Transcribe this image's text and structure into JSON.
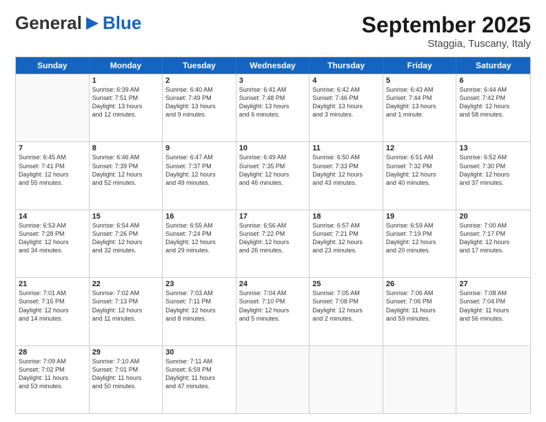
{
  "header": {
    "logo_general": "General",
    "logo_blue": "Blue",
    "month": "September 2025",
    "location": "Staggia, Tuscany, Italy"
  },
  "weekdays": [
    "Sunday",
    "Monday",
    "Tuesday",
    "Wednesday",
    "Thursday",
    "Friday",
    "Saturday"
  ],
  "rows": [
    [
      {
        "day": "",
        "lines": []
      },
      {
        "day": "1",
        "lines": [
          "Sunrise: 6:39 AM",
          "Sunset: 7:51 PM",
          "Daylight: 13 hours",
          "and 12 minutes."
        ]
      },
      {
        "day": "2",
        "lines": [
          "Sunrise: 6:40 AM",
          "Sunset: 7:49 PM",
          "Daylight: 13 hours",
          "and 9 minutes."
        ]
      },
      {
        "day": "3",
        "lines": [
          "Sunrise: 6:41 AM",
          "Sunset: 7:48 PM",
          "Daylight: 13 hours",
          "and 6 minutes."
        ]
      },
      {
        "day": "4",
        "lines": [
          "Sunrise: 6:42 AM",
          "Sunset: 7:46 PM",
          "Daylight: 13 hours",
          "and 3 minutes."
        ]
      },
      {
        "day": "5",
        "lines": [
          "Sunrise: 6:43 AM",
          "Sunset: 7:44 PM",
          "Daylight: 13 hours",
          "and 1 minute."
        ]
      },
      {
        "day": "6",
        "lines": [
          "Sunrise: 6:44 AM",
          "Sunset: 7:42 PM",
          "Daylight: 12 hours",
          "and 58 minutes."
        ]
      }
    ],
    [
      {
        "day": "7",
        "lines": [
          "Sunrise: 6:45 AM",
          "Sunset: 7:41 PM",
          "Daylight: 12 hours",
          "and 55 minutes."
        ]
      },
      {
        "day": "8",
        "lines": [
          "Sunrise: 6:46 AM",
          "Sunset: 7:39 PM",
          "Daylight: 12 hours",
          "and 52 minutes."
        ]
      },
      {
        "day": "9",
        "lines": [
          "Sunrise: 6:47 AM",
          "Sunset: 7:37 PM",
          "Daylight: 12 hours",
          "and 49 minutes."
        ]
      },
      {
        "day": "10",
        "lines": [
          "Sunrise: 6:49 AM",
          "Sunset: 7:35 PM",
          "Daylight: 12 hours",
          "and 46 minutes."
        ]
      },
      {
        "day": "11",
        "lines": [
          "Sunrise: 6:50 AM",
          "Sunset: 7:33 PM",
          "Daylight: 12 hours",
          "and 43 minutes."
        ]
      },
      {
        "day": "12",
        "lines": [
          "Sunrise: 6:51 AM",
          "Sunset: 7:32 PM",
          "Daylight: 12 hours",
          "and 40 minutes."
        ]
      },
      {
        "day": "13",
        "lines": [
          "Sunrise: 6:52 AM",
          "Sunset: 7:30 PM",
          "Daylight: 12 hours",
          "and 37 minutes."
        ]
      }
    ],
    [
      {
        "day": "14",
        "lines": [
          "Sunrise: 6:53 AM",
          "Sunset: 7:28 PM",
          "Daylight: 12 hours",
          "and 34 minutes."
        ]
      },
      {
        "day": "15",
        "lines": [
          "Sunrise: 6:54 AM",
          "Sunset: 7:26 PM",
          "Daylight: 12 hours",
          "and 32 minutes."
        ]
      },
      {
        "day": "16",
        "lines": [
          "Sunrise: 6:55 AM",
          "Sunset: 7:24 PM",
          "Daylight: 12 hours",
          "and 29 minutes."
        ]
      },
      {
        "day": "17",
        "lines": [
          "Sunrise: 6:56 AM",
          "Sunset: 7:22 PM",
          "Daylight: 12 hours",
          "and 26 minutes."
        ]
      },
      {
        "day": "18",
        "lines": [
          "Sunrise: 6:57 AM",
          "Sunset: 7:21 PM",
          "Daylight: 12 hours",
          "and 23 minutes."
        ]
      },
      {
        "day": "19",
        "lines": [
          "Sunrise: 6:59 AM",
          "Sunset: 7:19 PM",
          "Daylight: 12 hours",
          "and 20 minutes."
        ]
      },
      {
        "day": "20",
        "lines": [
          "Sunrise: 7:00 AM",
          "Sunset: 7:17 PM",
          "Daylight: 12 hours",
          "and 17 minutes."
        ]
      }
    ],
    [
      {
        "day": "21",
        "lines": [
          "Sunrise: 7:01 AM",
          "Sunset: 7:15 PM",
          "Daylight: 12 hours",
          "and 14 minutes."
        ]
      },
      {
        "day": "22",
        "lines": [
          "Sunrise: 7:02 AM",
          "Sunset: 7:13 PM",
          "Daylight: 12 hours",
          "and 11 minutes."
        ]
      },
      {
        "day": "23",
        "lines": [
          "Sunrise: 7:03 AM",
          "Sunset: 7:11 PM",
          "Daylight: 12 hours",
          "and 8 minutes."
        ]
      },
      {
        "day": "24",
        "lines": [
          "Sunrise: 7:04 AM",
          "Sunset: 7:10 PM",
          "Daylight: 12 hours",
          "and 5 minutes."
        ]
      },
      {
        "day": "25",
        "lines": [
          "Sunrise: 7:05 AM",
          "Sunset: 7:08 PM",
          "Daylight: 12 hours",
          "and 2 minutes."
        ]
      },
      {
        "day": "26",
        "lines": [
          "Sunrise: 7:06 AM",
          "Sunset: 7:06 PM",
          "Daylight: 11 hours",
          "and 59 minutes."
        ]
      },
      {
        "day": "27",
        "lines": [
          "Sunrise: 7:08 AM",
          "Sunset: 7:04 PM",
          "Daylight: 11 hours",
          "and 56 minutes."
        ]
      }
    ],
    [
      {
        "day": "28",
        "lines": [
          "Sunrise: 7:09 AM",
          "Sunset: 7:02 PM",
          "Daylight: 11 hours",
          "and 53 minutes."
        ]
      },
      {
        "day": "29",
        "lines": [
          "Sunrise: 7:10 AM",
          "Sunset: 7:01 PM",
          "Daylight: 11 hours",
          "and 50 minutes."
        ]
      },
      {
        "day": "30",
        "lines": [
          "Sunrise: 7:11 AM",
          "Sunset: 6:59 PM",
          "Daylight: 11 hours",
          "and 47 minutes."
        ]
      },
      {
        "day": "",
        "lines": []
      },
      {
        "day": "",
        "lines": []
      },
      {
        "day": "",
        "lines": []
      },
      {
        "day": "",
        "lines": []
      }
    ]
  ]
}
